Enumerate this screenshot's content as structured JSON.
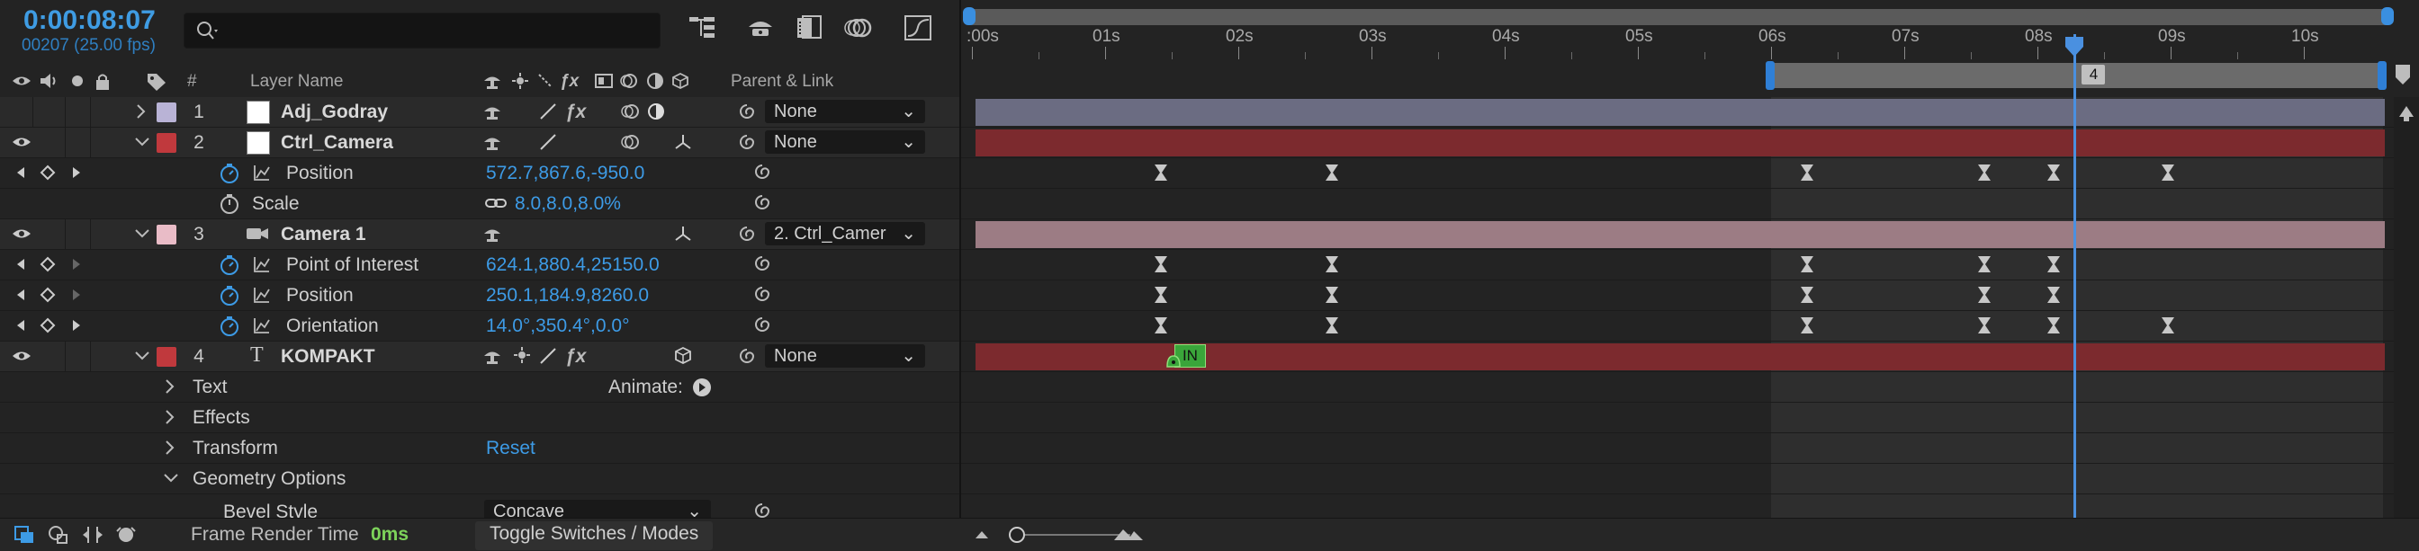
{
  "header": {
    "timecode": "0:00:08:07",
    "frame_info": "00207 (25.00 fps)",
    "search_placeholder": ""
  },
  "columns": {
    "number": "#",
    "layer_name": "Layer Name",
    "parent_link": "Parent & Link"
  },
  "rows": [
    {
      "kind": "layer",
      "num": "1",
      "name": "Adj_Godray",
      "label_color": "#b9b3d6",
      "parent": "None"
    },
    {
      "kind": "layer",
      "num": "2",
      "name": "Ctrl_Camera",
      "label_color": "#c0393d",
      "parent": "None"
    },
    {
      "kind": "prop",
      "name": "Position",
      "value": "572.7,867.6,-950.0"
    },
    {
      "kind": "prop",
      "name": "Scale",
      "value": "8.0,8.0,8.0%"
    },
    {
      "kind": "layer",
      "num": "3",
      "name": "Camera 1",
      "label_color": "#e9bcc7",
      "parent": "2. Ctrl_Camer"
    },
    {
      "kind": "prop",
      "name": "Point of Interest",
      "value": "624.1,880.4,25150.0"
    },
    {
      "kind": "prop",
      "name": "Position",
      "value": "250.1,184.9,8260.0"
    },
    {
      "kind": "prop",
      "name": "Orientation",
      "value": "14.0°,350.4°,0.0°"
    },
    {
      "kind": "layer",
      "num": "4",
      "name": "KOMPAKT",
      "label_color": "#c0393d",
      "parent": "None"
    },
    {
      "kind": "group",
      "name": "Text",
      "extra": "Animate:"
    },
    {
      "kind": "group",
      "name": "Effects"
    },
    {
      "kind": "group",
      "name": "Transform",
      "extra_link": "Reset"
    },
    {
      "kind": "group",
      "name": "Geometry Options"
    },
    {
      "kind": "prop",
      "name": "Bevel Style",
      "dropdown": "Concave"
    }
  ],
  "ruler": {
    "ticks": [
      ":00s",
      "01s",
      "02s",
      "03s",
      "04s",
      "05s",
      "06s",
      "07s",
      "08s",
      "09s",
      "10s"
    ],
    "playhead_label": "4",
    "playhead_seconds": 8.28,
    "seconds_visible": 10.46,
    "work_area_start_s": 6.0
  },
  "tracks": [
    {
      "bar": "#6b6c82"
    },
    {
      "bar": "#7c2a2e"
    },
    {
      "keys": [
        1.42,
        2.7,
        6.27,
        7.6,
        8.12,
        8.98
      ]
    },
    {
      "keys": []
    },
    {
      "bar": "#9c7c84"
    },
    {
      "keys": [
        1.42,
        2.7,
        6.27,
        7.6,
        8.12
      ]
    },
    {
      "keys": [
        1.42,
        2.7,
        6.27,
        7.6,
        8.12
      ]
    },
    {
      "keys": [
        1.42,
        2.7,
        6.27,
        7.6,
        8.12,
        8.98
      ]
    },
    {
      "bar": "#7c2a2e",
      "in_marker": "IN",
      "in_s": 1.52
    },
    {
      "keys": []
    },
    {
      "keys": []
    },
    {
      "keys": []
    },
    {
      "keys": []
    },
    {
      "keys": []
    }
  ],
  "footer": {
    "render_label": "Frame Render Time",
    "render_value": "0ms",
    "toggle_label": "Toggle Switches / Modes"
  },
  "colors": {
    "accent": "#3f9ce3",
    "playhead": "#4a90e0",
    "green": "#7dd35a"
  }
}
